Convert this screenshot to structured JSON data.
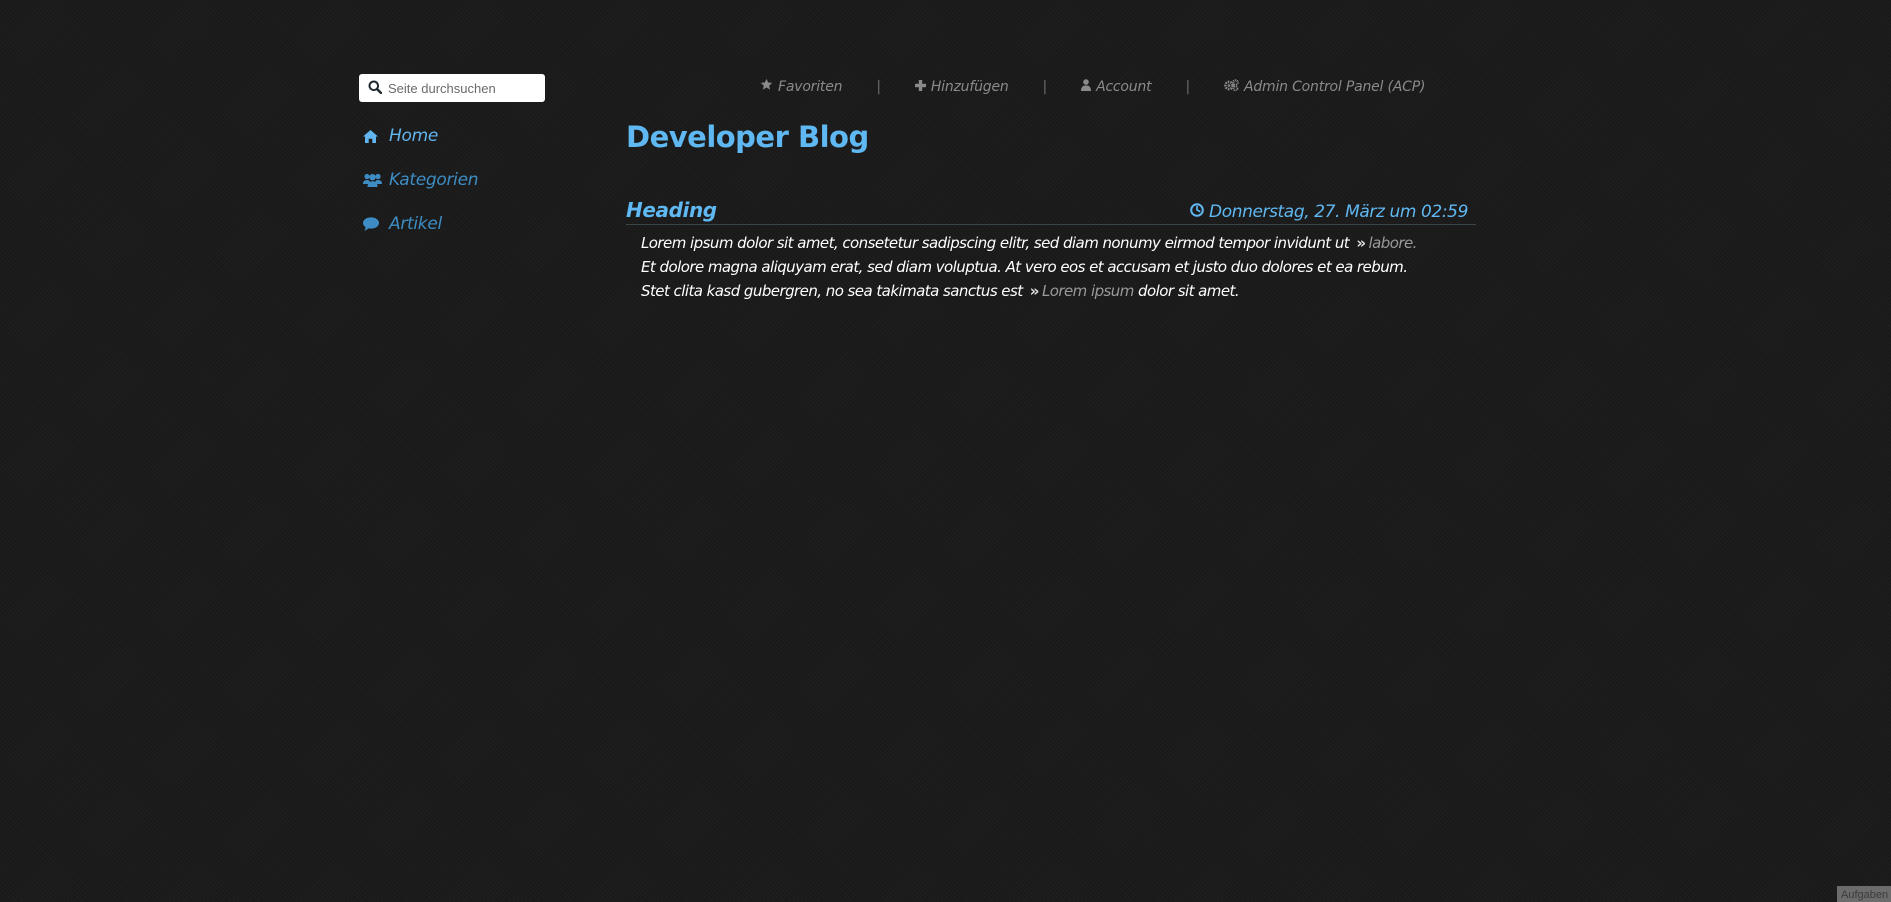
{
  "search": {
    "placeholder": "Seite durchsuchen"
  },
  "sidebar": {
    "items": [
      {
        "label": "Home",
        "icon": "home-icon",
        "active": true
      },
      {
        "label": "Kategorien",
        "icon": "users-icon",
        "active": false
      },
      {
        "label": "Artikel",
        "icon": "comment-icon",
        "active": false
      }
    ]
  },
  "topnav": {
    "items": [
      {
        "label": "Favoriten",
        "icon": "star-icon"
      },
      {
        "label": "Hinzufügen",
        "icon": "plus-icon"
      },
      {
        "label": "Account",
        "icon": "user-icon"
      },
      {
        "label": "Admin Control Panel (ACP)",
        "icon": "cogs-icon"
      }
    ],
    "separator": "|"
  },
  "blog": {
    "title": "Developer Blog"
  },
  "post": {
    "heading": "Heading",
    "date": "Donnerstag, 27. März um 02:59",
    "date_icon": "clock-icon",
    "body": {
      "part1": "Lorem ipsum dolor sit amet, consetetur sadipscing elitr, sed diam nonumy eirmod tempor invidunt ut",
      "link1": "labore.",
      "part2": "Et dolore magna aliquyam erat, sed diam voluptua. At vero eos et accusam et justo duo dolores et ea rebum. Stet clita kasd gubergren, no sea takimata sanctus est",
      "link2": "Lorem ipsum",
      "part3": "dolor sit amet.",
      "link_marker": "»"
    }
  },
  "corner_tab": {
    "label": "Aufgaben"
  },
  "colors": {
    "background": "#1b1b1b",
    "accent": "#5fb8f2",
    "nav_inactive": "#3d8dc4",
    "topnav_text": "#8a8a8a",
    "body_text": "#ffffff",
    "link_text": "#9a9a9a"
  }
}
